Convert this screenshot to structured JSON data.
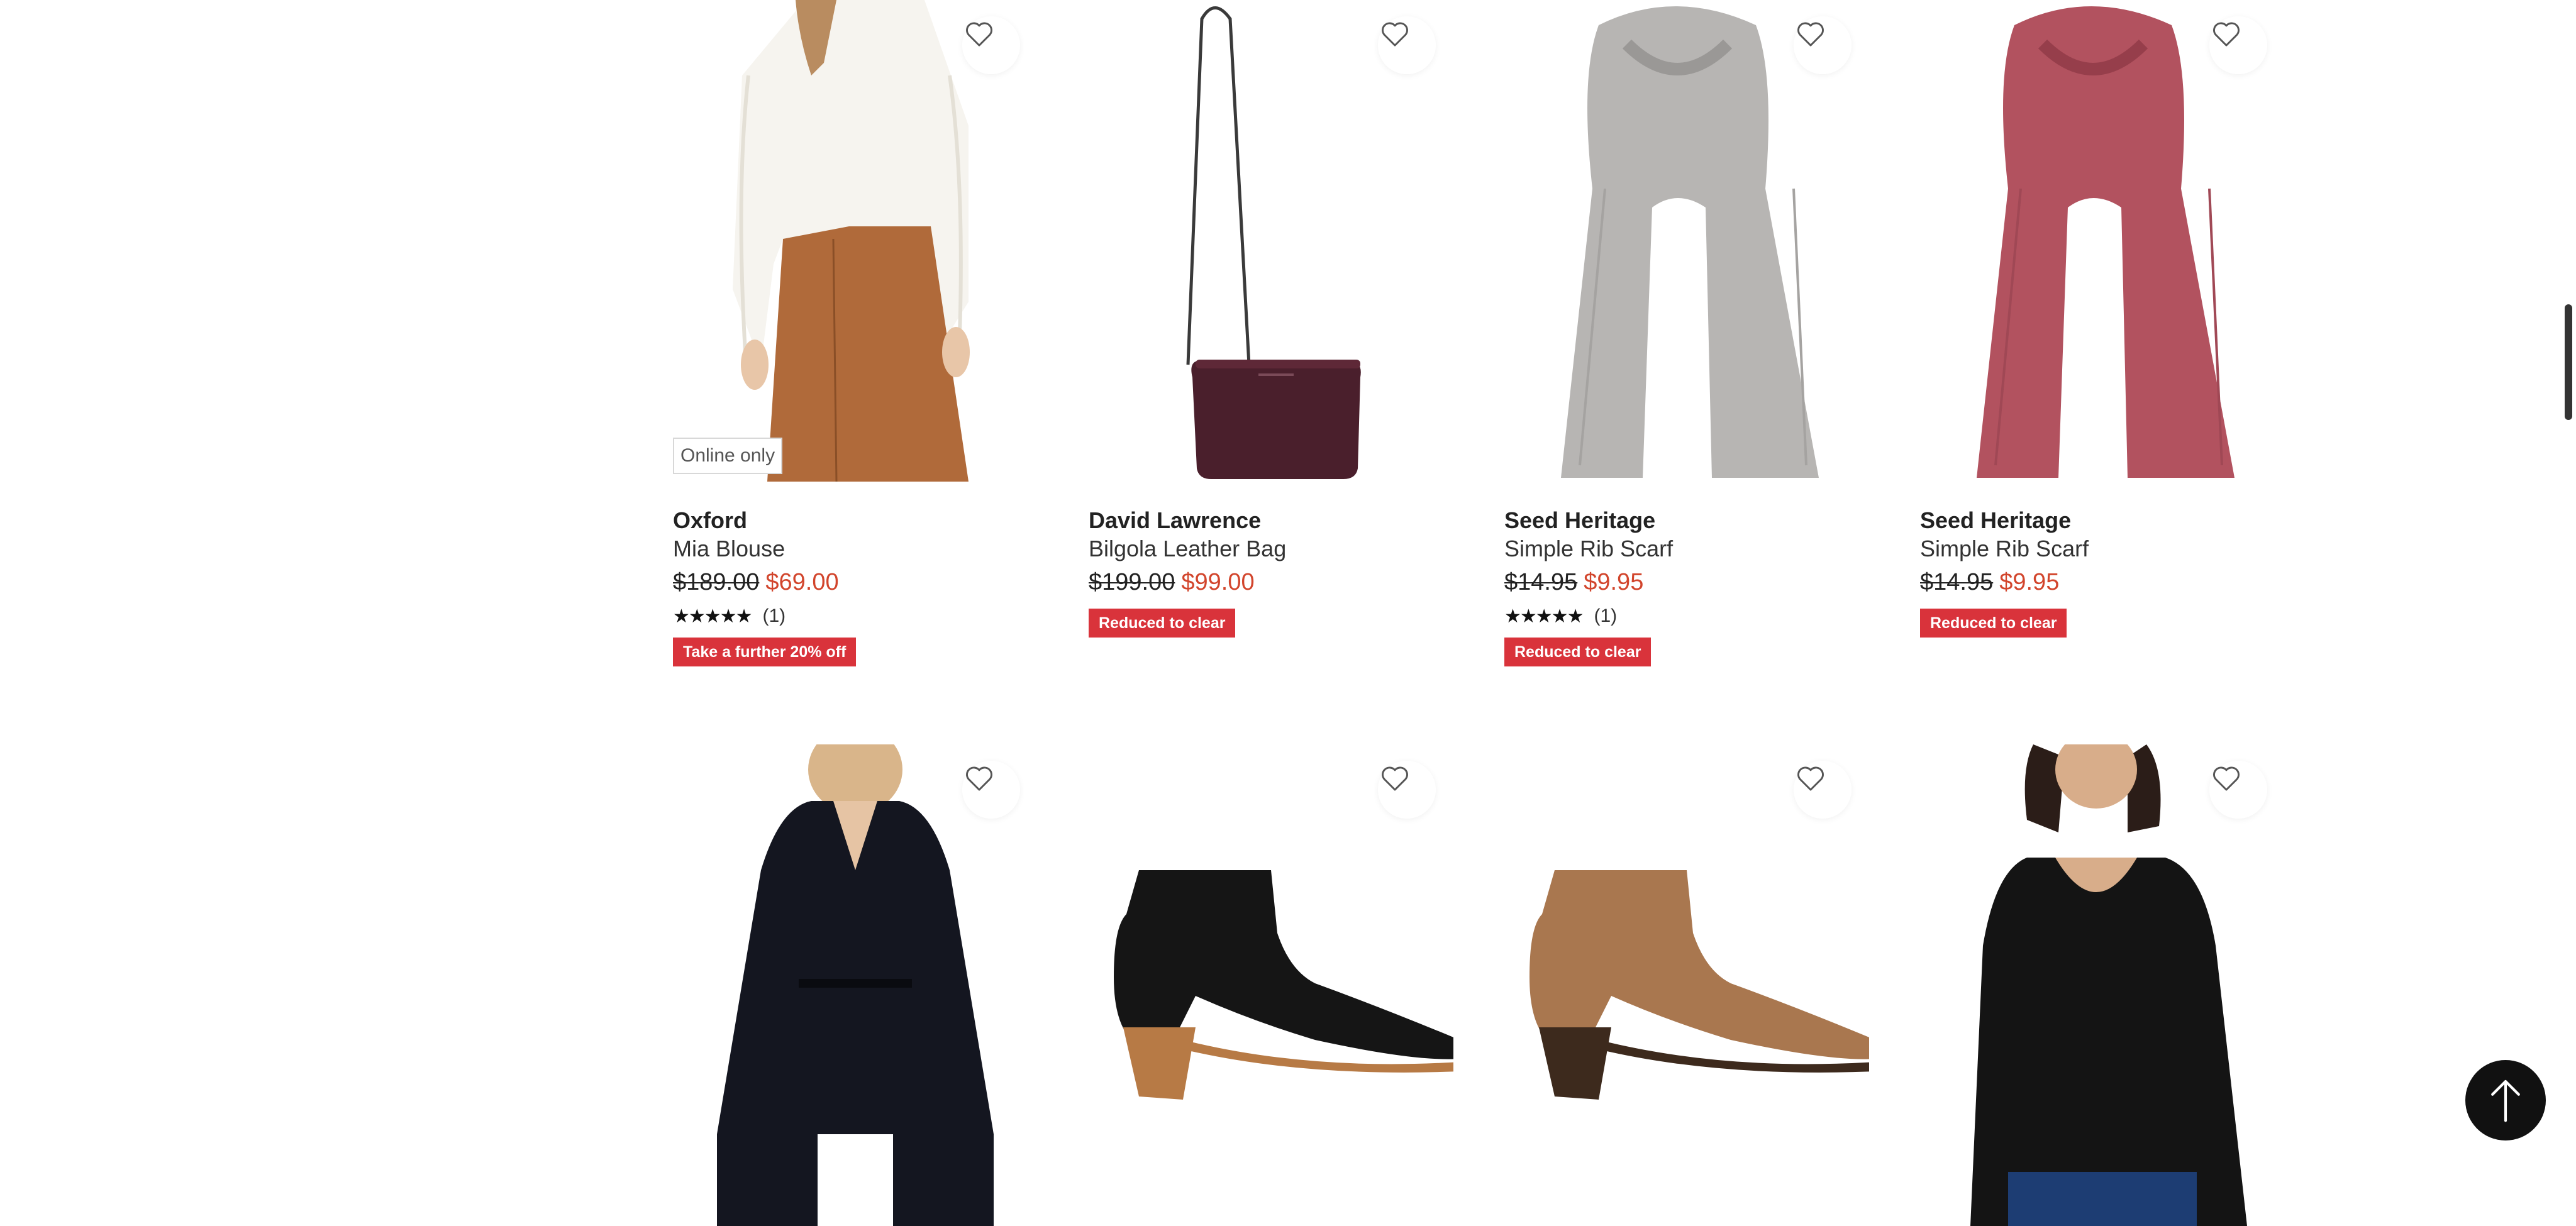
{
  "products_row1": [
    {
      "brand": "Oxford",
      "name": "Mia Blouse",
      "price_was": "$189.00",
      "price_now": "$69.00",
      "rating_count": "(1)",
      "badge": "Online only",
      "tag": "Take a further 20% off",
      "image": "model-white-blouse-brown-leather-skirt"
    },
    {
      "brand": "David Lawrence",
      "name": "Bilgola Leather Bag",
      "price_was": "$199.00",
      "price_now": "$99.00",
      "tag": "Reduced to clear",
      "image": "burgundy-crossbody-bag"
    },
    {
      "brand": "Seed Heritage",
      "name": "Simple Rib Scarf",
      "price_was": "$14.95",
      "price_now": "$9.95",
      "rating_count": "(1)",
      "tag": "Reduced to clear",
      "image": "grey-rib-scarf"
    },
    {
      "brand": "Seed Heritage",
      "name": "Simple Rib Scarf",
      "price_was": "$14.95",
      "price_now": "$9.95",
      "tag": "Reduced to clear",
      "image": "rose-rib-scarf"
    }
  ],
  "products_row2": [
    {
      "image": "model-black-cape-blazer"
    },
    {
      "image": "black-leather-ankle-boot"
    },
    {
      "image": "tan-leather-ankle-boot"
    },
    {
      "image": "model-black-long-sleeve-top"
    }
  ],
  "rating_stars": "★★★★★",
  "icons": {
    "wishlist": "heart-outline-icon",
    "back_to_top": "arrow-up-icon"
  },
  "colors": {
    "sale_price": "#d2452c",
    "tag_bg": "#d9333b",
    "back_to_top_bg": "#111111"
  }
}
